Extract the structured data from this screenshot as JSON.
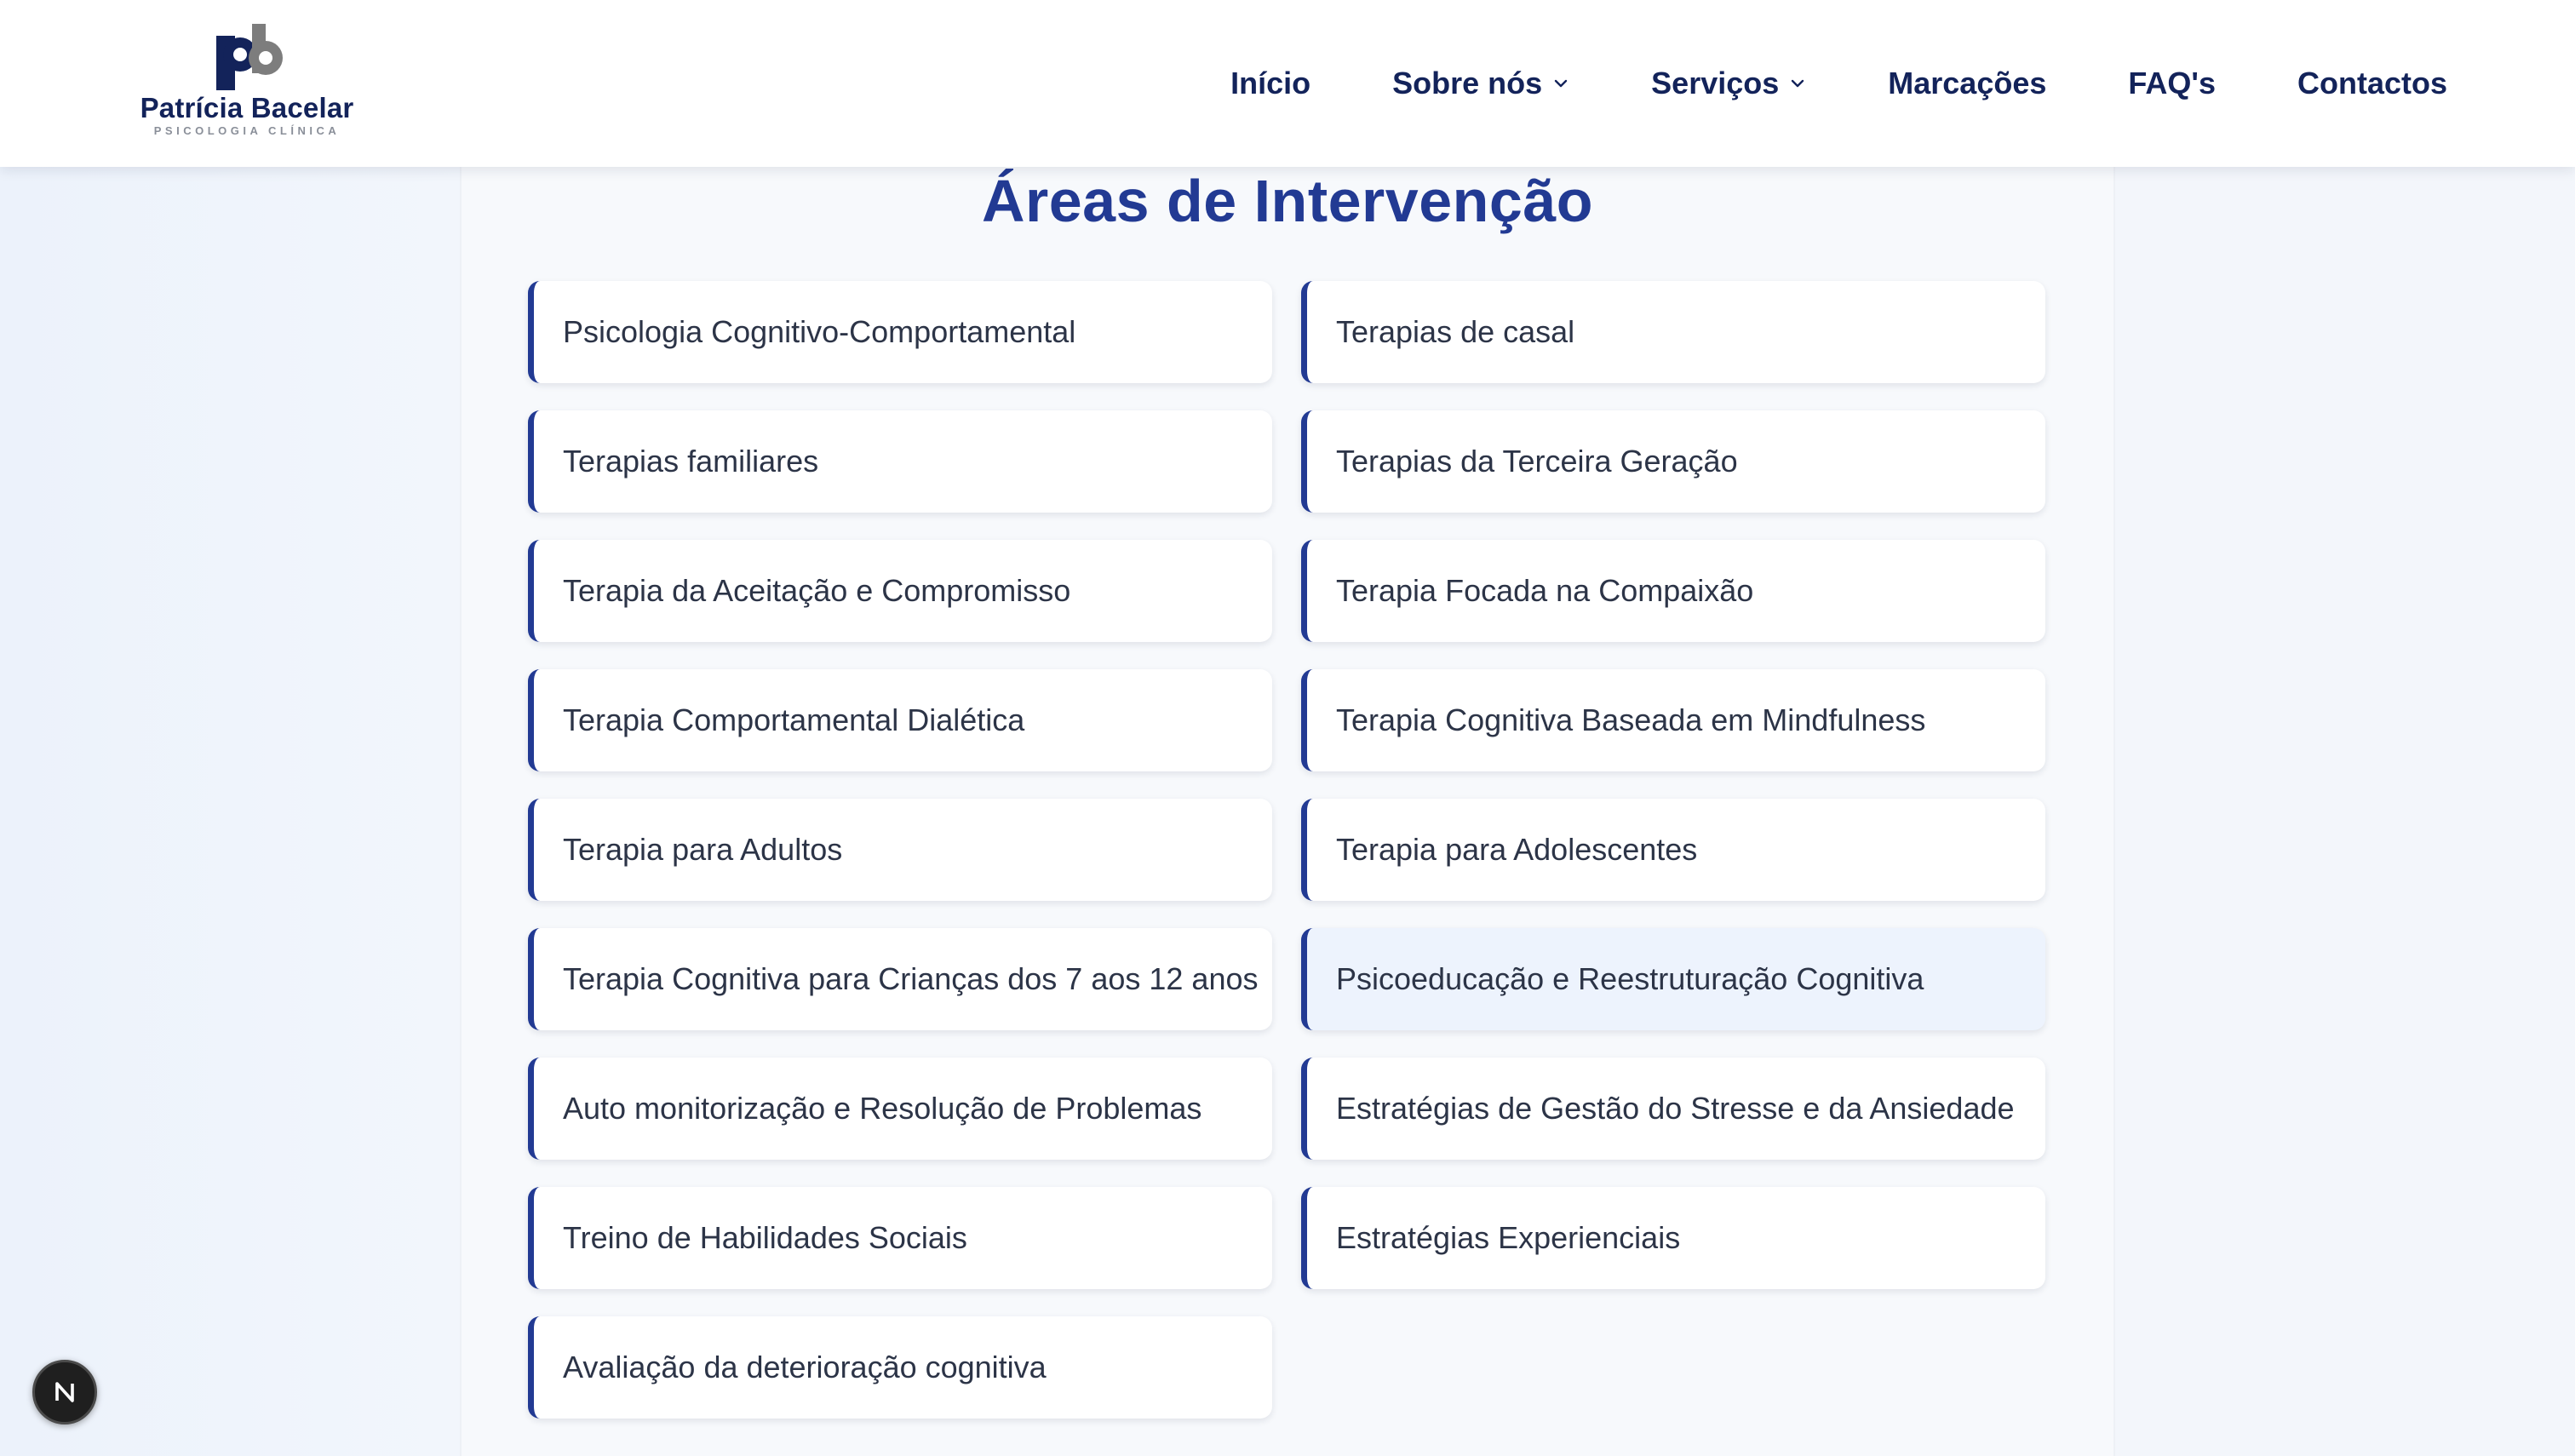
{
  "brand": {
    "name": "Patrícia Bacelar",
    "subtitle": "PSICOLOGIA CLÍNICA",
    "logo_letters": "pb",
    "primary_color": "#223a93",
    "text_color": "#13235a"
  },
  "nav": {
    "items": [
      {
        "label": "Início",
        "has_dropdown": false
      },
      {
        "label": "Sobre nós",
        "has_dropdown": true
      },
      {
        "label": "Serviços",
        "has_dropdown": true
      },
      {
        "label": "Marcações",
        "has_dropdown": false
      },
      {
        "label": "FAQ's",
        "has_dropdown": false
      },
      {
        "label": "Contactos",
        "has_dropdown": false
      }
    ]
  },
  "section": {
    "title": "Áreas de Intervenção",
    "cards": [
      "Psicologia Cognitivo-Comportamental",
      "Terapias de casal",
      "Terapias familiares",
      "Terapias da Terceira Geração",
      "Terapia da Aceitação e Compromisso",
      "Terapia Focada na Compaixão",
      "Terapia Comportamental Dialética",
      "Terapia Cognitiva Baseada em Mindfulness",
      "Terapia para Adultos",
      "Terapia para Adolescentes",
      "Terapia Cognitiva para Crianças dos 7 aos 12 anos",
      "Psicoeducação e Reestruturação Cognitiva",
      "Auto monitorização e Resolução de Problemas",
      "Estratégias de Gestão do Stresse e da Ansiedade",
      "Treino de Habilidades Sociais",
      "Estratégias Experienciais",
      "Avaliação da deterioração cognitiva"
    ],
    "hovered_card": "Psicoeducação e Reestruturação Cognitiva"
  },
  "dev_badge": {
    "letter": "N",
    "icon": "nextjs-dev-indicator-icon"
  }
}
